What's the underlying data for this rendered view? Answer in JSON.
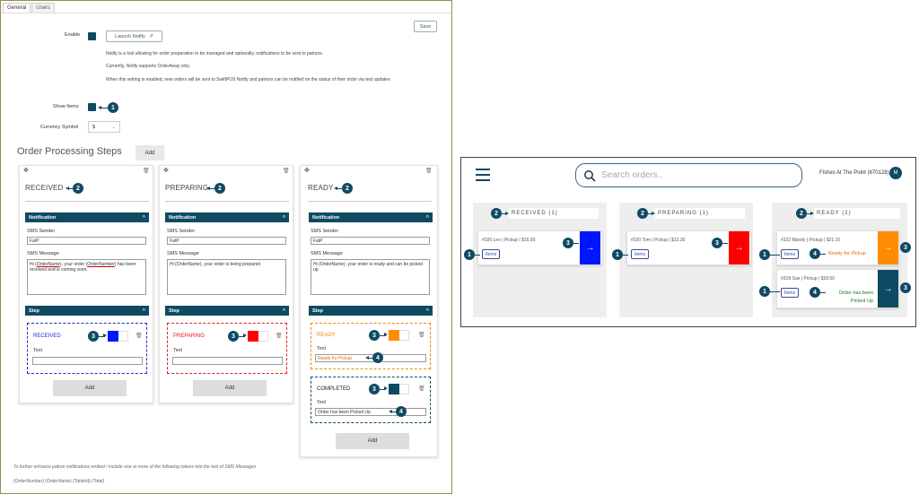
{
  "tabs": [
    {
      "label": "General"
    },
    {
      "label": "Users"
    }
  ],
  "save_label": "Save",
  "enable_label": "Enable",
  "launch_notify_label": "Launch Notify",
  "description": {
    "p1": "Notify is a tool allowing for order preparation to be managed and optionally, notifications to be sent to patrons.",
    "p2": "Currently, Notify supports OrderAway only.",
    "p3": "When this setting is enabled, new orders will be sent to SwiftPOS Notify and patrons can be notified on the status of their order via text updates"
  },
  "show_items_label": "Show Items",
  "currency_label": "Currency Symbol",
  "currency_value": "$",
  "steps_title": "Order Processing Steps",
  "add_label": "Add",
  "callouts": {
    "c1": "1",
    "c2": "2",
    "c3": "3",
    "c4": "4"
  },
  "notification_label": "Notification",
  "step_label": "Step",
  "sms_sender_label": "SMS Sender",
  "sms_message_label": "SMS Message",
  "text_label": "Text",
  "cards": [
    {
      "title": "RECEIVED",
      "sender": "FatP",
      "message_pre": "Hi (",
      "token1": "OrderName",
      "message_mid": "), your order (",
      "token2": "OrderNumber",
      "message_post": ") has been received and is coming soon.",
      "step_name": "RECEIVED",
      "step_color": "#1a2bd6",
      "swatch": "#0015ff",
      "text_value": ""
    },
    {
      "title": "PREPARING",
      "sender": "FatP",
      "message": "Hi (OrderName), your order is being prepared",
      "step_name": "PREPARING",
      "step_color": "#e02020",
      "swatch": "#ff0000",
      "text_value": ""
    },
    {
      "title": "READY",
      "sender": "FatP",
      "message": "Hi (OrderName), your order is ready and can be picked up",
      "steps": [
        {
          "name": "READY",
          "color": "#f08a00",
          "swatch": "#ff8c00",
          "text": "Ready for Pickup"
        },
        {
          "name": "COMPLETED",
          "color": "#0f4a63",
          "swatch": "#0f4a63",
          "text": "Order has been Picked Up"
        }
      ]
    }
  ],
  "footer": {
    "note": "To further enhance patron notifications embed / include one or more of the following tokens into the text of SMS Messages",
    "tokens": "(OrderNumber) (OrderName) (TableId) (Total)"
  },
  "app": {
    "search_placeholder": "Search orders..",
    "venue": "Fishes At The Point (670128)",
    "avatar": "M",
    "columns": [
      {
        "label": "RECEIVED (1)"
      },
      {
        "label": "PREPARING (1)"
      },
      {
        "label": "READY (2)"
      }
    ],
    "orders": [
      {
        "number": "#326",
        "name": "Leo",
        "type": "Pickup",
        "total": "$15.00",
        "items": "Items",
        "color": "#0015ff",
        "status": ""
      },
      {
        "number": "#320",
        "name": "Tom",
        "type": "Pickup",
        "total": "$12.30",
        "items": "Items",
        "color": "#ff0000",
        "status": ""
      },
      {
        "number": "#322",
        "name": "Mandy",
        "type": "Pickup",
        "total": "$21.15",
        "items": "Items",
        "color": "#ff8c00",
        "status": "Ready for Pickup"
      },
      {
        "number": "#318",
        "name": "Sue",
        "type": "Pickup",
        "total": "$18.50",
        "items": "Items",
        "color": "#0f4a63",
        "status": "Order has been Picked Up"
      }
    ],
    "sep": "|",
    "arrow": "→"
  },
  "colors": {
    "primary": "#0f4a63",
    "received": "#0015ff",
    "preparing": "#ff0000",
    "ready": "#ff8c00",
    "completed": "#0f4a63",
    "ready_text": "#e07000",
    "completed_text": "#1a7a1a"
  }
}
